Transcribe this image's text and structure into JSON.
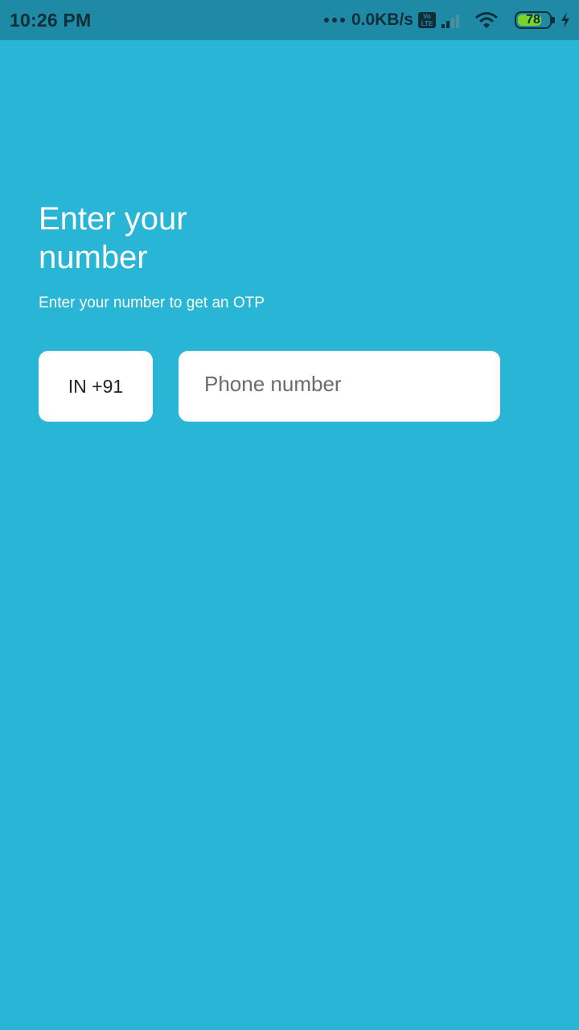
{
  "status_bar": {
    "time": "10:26 PM",
    "network_speed": "0.0KB/s",
    "volte_top": "Vo",
    "volte_bottom": "LTE",
    "battery_level": "78",
    "battery_fraction": 0.78,
    "icons": [
      "dots-icon",
      "volte-icon",
      "signal-icon",
      "wifi-icon",
      "battery-icon",
      "charging-icon"
    ],
    "battery_fill_color": "#7bd32a"
  },
  "screen": {
    "title": "Enter your number",
    "subtitle": "Enter your number to get an OTP",
    "country_code": "IN +91",
    "phone_placeholder": "Phone number",
    "phone_value": ""
  },
  "colors": {
    "background": "#29b6d6",
    "status_bar": "#1f8aa6",
    "field": "#ffffff"
  }
}
